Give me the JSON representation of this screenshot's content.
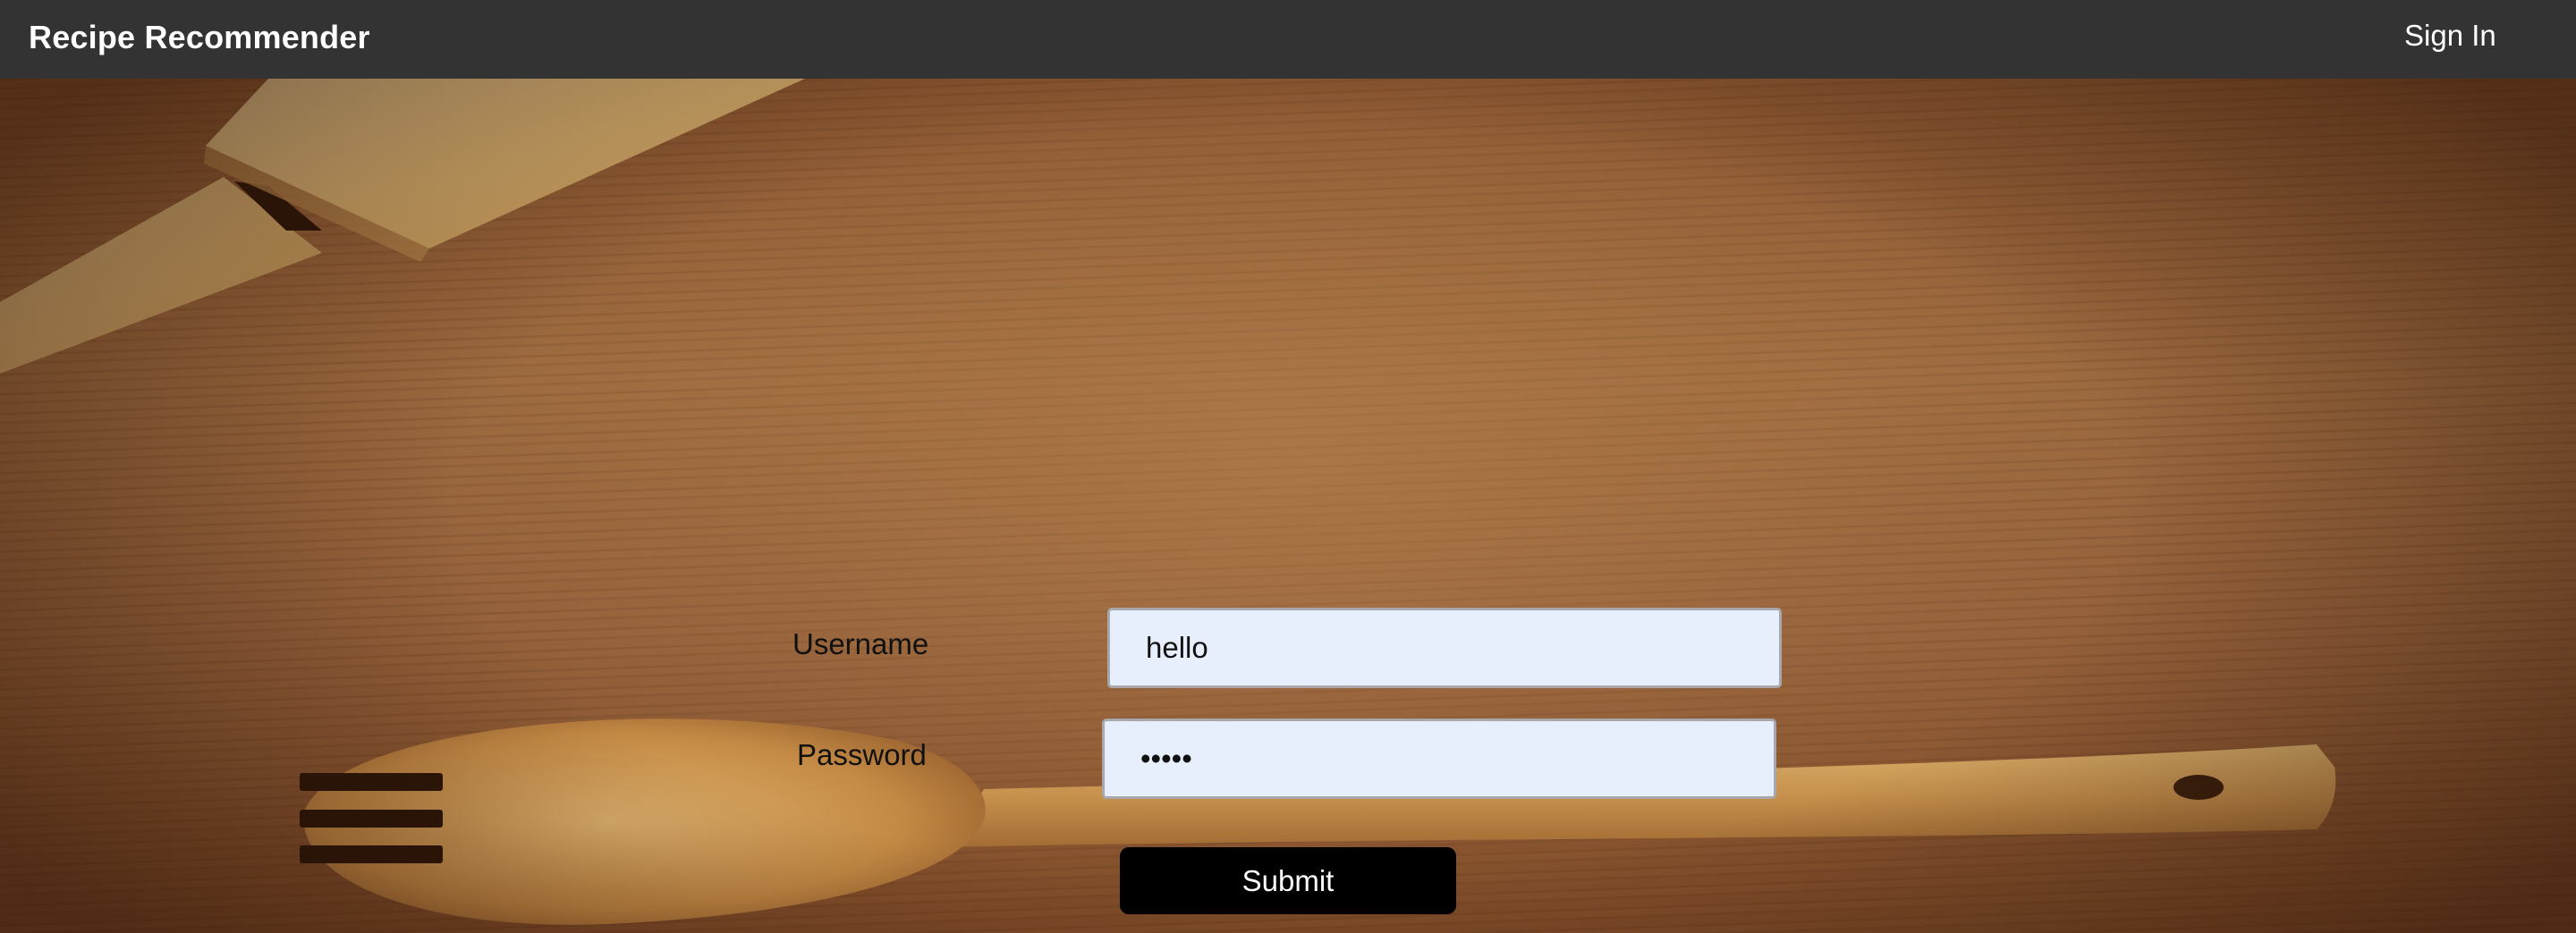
{
  "navbar": {
    "brand": "Recipe Recommender",
    "sign_in_label": "Sign In"
  },
  "form": {
    "username_label": "Username",
    "username_value": "hello",
    "password_label": "Password",
    "password_value": "hello",
    "submit_label": "Submit"
  },
  "colors": {
    "navbar_bg": "#333333",
    "input_bg": "#e8effc",
    "button_bg": "#000000"
  },
  "icons": {
    "background": "wooden-table-with-spatula-and-spork"
  }
}
